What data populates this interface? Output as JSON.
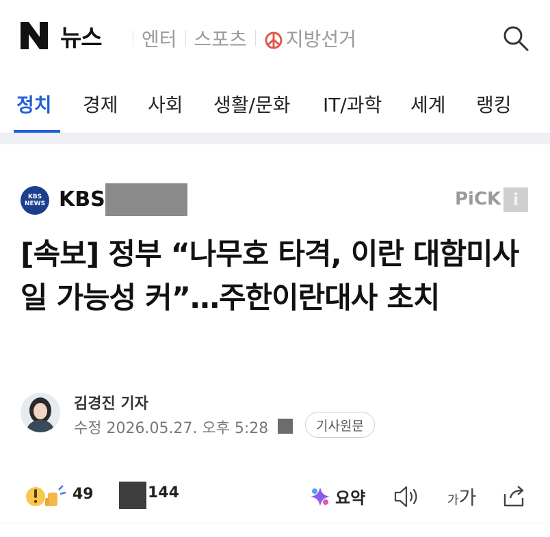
{
  "header": {
    "logo_letter": "N",
    "logo_text": "뉴스",
    "top_nav": [
      {
        "label": "엔터"
      },
      {
        "label": "스포츠"
      },
      {
        "label": "지방선거"
      }
    ]
  },
  "categories": [
    "정치",
    "경제",
    "사회",
    "생활/문화",
    "IT/과학",
    "세계",
    "랭킹"
  ],
  "article": {
    "press_logo_text": "KBS NEWS",
    "press_name": "KBS",
    "pick_label": "PiCK",
    "pick_info_glyph": "i",
    "headline": "[속보] 정부 “나무호 타격, 이란 대함미사일 가능성 커”…주한이란대사 초치",
    "reporter": "김경진 기자",
    "date": "수정 2026.05.27. 오후 5:28",
    "original_button": "기사원문"
  },
  "actions": {
    "reaction_count": "49",
    "comment_count": "144",
    "summary_label": "요약",
    "font_small": "가",
    "font_big": "가"
  },
  "colors": {
    "accent": "#1f5fd7",
    "press_logo_bg": "#1b3f8f"
  }
}
